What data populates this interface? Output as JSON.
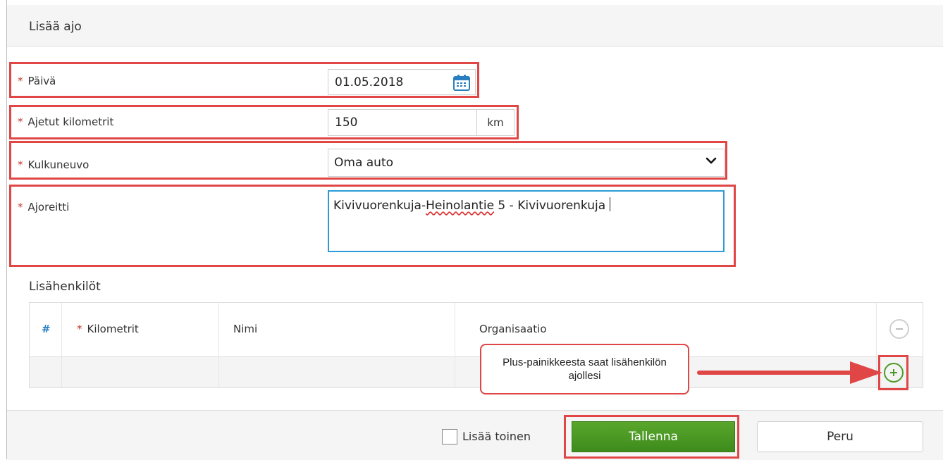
{
  "dialog": {
    "title": "Lisää ajo"
  },
  "form": {
    "required_marker": "*",
    "date": {
      "label": "Päivä",
      "value": "01.05.2018"
    },
    "kilometers": {
      "label": "Ajetut kilometrit",
      "value": "150",
      "unit": "km"
    },
    "vehicle": {
      "label": "Kulkuneuvo",
      "selected": "Oma auto"
    },
    "route": {
      "label": "Ajoreitti",
      "value_before": "Kivivuorenkuja-",
      "value_misspelled": "Heinolantie",
      "value_after": " 5 - Kivivuorenkuja"
    }
  },
  "extra_persons": {
    "title": "Lisähenkilöt",
    "columns": {
      "number": "#",
      "kilometers": "Kilometrit",
      "name": "Nimi",
      "organization": "Organisaatio"
    },
    "remove_icon": "minus-circle-icon",
    "add_icon": "plus-circle-icon"
  },
  "callout": {
    "text": "Plus-painikkeesta saat lisähenkilön ajollesi"
  },
  "footer": {
    "add_another_label": "Lisää toinen",
    "add_another_checked": false,
    "save_label": "Tallenna",
    "cancel_label": "Peru"
  },
  "colors": {
    "highlight": "#e04646",
    "save_button": "#4b9a24",
    "focus_border": "#2e9bd6",
    "required": "#c0392b"
  }
}
